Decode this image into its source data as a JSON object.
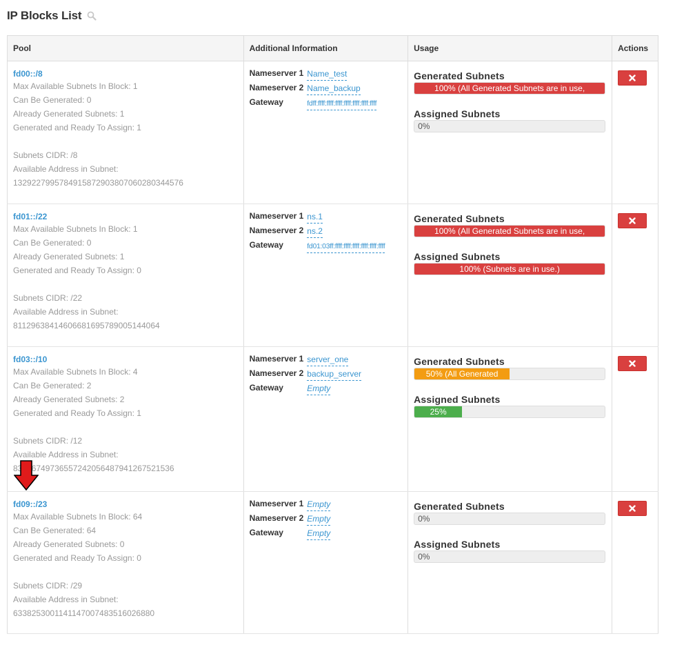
{
  "page": {
    "title": "IP Blocks List",
    "search_icon": "search-icon"
  },
  "table": {
    "headers": {
      "pool": "Pool",
      "info": "Additional Information",
      "usage": "Usage",
      "actions": "Actions"
    },
    "labels": {
      "ns1": "Nameserver 1",
      "ns2": "Nameserver 2",
      "gateway": "Gateway",
      "generated": "Generated Subnets",
      "assigned": "Assigned Subnets"
    },
    "rows": [
      {
        "pool": "fd00::/8",
        "max_available": "Max Available Subnets In Block: 1",
        "can_be_generated": "Can Be Generated: 0",
        "already_generated": "Already Generated Subnets: 1",
        "ready_to_assign": "Generated and Ready To Assign: 1",
        "cidr": "Subnets CIDR: /8",
        "available_label": "Available Address in Subnet:",
        "available_value": "1329227995784915872903807060280344576",
        "ns1": "Name_test",
        "ns2": "Name_backup",
        "gateway": "fdff:ffff:ffff:ffff:ffff:ffff:ffff:ffff",
        "generated_text": "100% (All Generated Subnets are in use,",
        "generated_percent": 100,
        "generated_color": "#d9403f",
        "assigned_text": "0%",
        "assigned_percent": 0,
        "assigned_color": "#eeeeee"
      },
      {
        "pool": "fd01::/22",
        "max_available": "Max Available Subnets In Block: 1",
        "can_be_generated": "Can Be Generated: 0",
        "already_generated": "Already Generated Subnets: 1",
        "ready_to_assign": "Generated and Ready To Assign: 0",
        "cidr": "Subnets CIDR: /22",
        "available_label": "Available Address in Subnet:",
        "available_value": "81129638414606681695789005144064",
        "ns1": "ns.1",
        "ns2": "ns.2",
        "gateway": "fd01:03ff:ffff:ffff:ffff:ffff:ffff:ffff",
        "generated_text": "100% (All Generated Subnets are in use,",
        "generated_percent": 100,
        "generated_color": "#d9403f",
        "assigned_text": "100% (Subnets are in use.)",
        "assigned_percent": 100,
        "assigned_color": "#d9403f"
      },
      {
        "pool": "fd03::/10",
        "max_available": "Max Available Subnets In Block: 4",
        "can_be_generated": "Can Be Generated: 2",
        "already_generated": "Already Generated Subnets: 2",
        "ready_to_assign": "Generated and Ready To Assign: 1",
        "cidr": "Subnets CIDR: /12",
        "available_label": "Available Address in Subnet:",
        "available_value": "83076749736557242056487941267521536",
        "ns1": "server_one",
        "ns2": "backup_server",
        "gateway": "Empty",
        "generated_text": "50% (All Generated",
        "generated_percent": 50,
        "generated_color": "#f39c12",
        "assigned_text": "25%",
        "assigned_percent": 25,
        "assigned_color": "#4cae4c"
      },
      {
        "pool": "fd09::/23",
        "max_available": "Max Available Subnets In Block: 64",
        "can_be_generated": "Can Be Generated: 64",
        "already_generated": "Already Generated Subnets: 0",
        "ready_to_assign": "Generated and Ready To Assign: 0",
        "cidr": "Subnets CIDR: /29",
        "available_label": "Available Address in Subnet:",
        "available_value": "6338253001141147007483516026880",
        "ns1": "Empty",
        "ns2": "Empty",
        "gateway": "Empty",
        "generated_text": "0%",
        "generated_percent": 0,
        "generated_color": "#eeeeee",
        "assigned_text": "0%",
        "assigned_percent": 0,
        "assigned_color": "#eeeeee"
      }
    ],
    "delete_icon": "close-icon"
  },
  "annotation": {
    "arrow_icon": "arrow-down-icon",
    "arrow_color": "#e01b1b"
  }
}
